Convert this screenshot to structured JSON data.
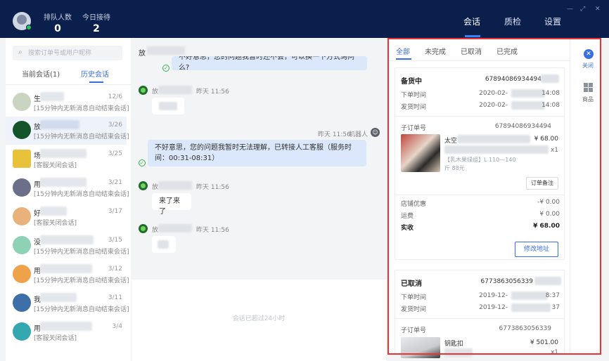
{
  "header": {
    "queue_label": "排队人数",
    "queue_value": "0",
    "today_label": "今日接待",
    "today_value": "2",
    "nav": [
      "会话",
      "质检",
      "设置"
    ]
  },
  "left": {
    "search_placeholder": "搜索订单号或用户昵称",
    "tabs": [
      "当前会话(1)",
      "历史会话"
    ],
    "conversations": [
      {
        "name": "生",
        "date": "12/6",
        "preview": "[15分钟内无新消息自动结束会话]"
      },
      {
        "name": "放",
        "date": "3/26",
        "preview": "[15分钟内无新消息自动结束会话]"
      },
      {
        "name": "场",
        "date": "3/25",
        "preview": "[客服关闭会话]"
      },
      {
        "name": "用",
        "date": "3/21",
        "preview": "[15分钟内无新消息自动结束会话]"
      },
      {
        "name": "好",
        "date": "3/17",
        "preview": "[客服关闭会话]"
      },
      {
        "name": "没",
        "date": "3/15",
        "preview": "[15分钟内无新消息自动结束会话]"
      },
      {
        "name": "用",
        "date": "3/12",
        "preview": "[15分钟内无新消息自动结束会话]"
      },
      {
        "name": "我",
        "date": "3/11",
        "preview": "[15分钟内无新消息自动结束会话]"
      },
      {
        "name": "用",
        "date": "3/4",
        "preview": "[客服关闭会话]"
      }
    ]
  },
  "chat": {
    "top_name": "放",
    "partial_msg": "不好意思，您的问题我暂时还不会，可以换一下方式询问么?",
    "user_name": "放",
    "time_yesterday": "昨天 11:56",
    "robot_label": "机器人",
    "agent_msg": "不好意思，您的问题我暂时无法理解，已转接人工客服（服务时间：00:31-08:31）",
    "user_msg2": "来了来了",
    "expired_tip": "会话已超过24小时"
  },
  "orders": {
    "tabs": [
      "全部",
      "未完成",
      "已取消",
      "已完成"
    ],
    "card1": {
      "status": "备货中",
      "order_no": "67894086934494",
      "placed_label": "下单时间",
      "placed_value": "2020-02-",
      "placed_time": "14:08",
      "ship_label": "发货时间",
      "ship_value": "2020-02-",
      "ship_time": "14:08",
      "sub_label": "子订单号",
      "sub_no": "67894086934494",
      "product_name": "太空",
      "price": "¥ 68.00",
      "qty": "x1",
      "spec": "【乳木果绿组】L 110—140",
      "spec2": "斤 88元",
      "note_button": "订单备注",
      "discount_label": "店铺优惠",
      "discount_value": "-¥ 0.00",
      "freight_label": "运费",
      "freight_value": "¥ 0.00",
      "paid_label": "实收",
      "paid_value": "¥ 68.00",
      "address_button": "修改地址"
    },
    "card2": {
      "status": "已取消",
      "order_no": "6773863056339",
      "placed_label": "下单时间",
      "placed_value": "2019-12-",
      "placed_time": "8:37",
      "ship_label": "发货时间",
      "ship_value": "2019-12-",
      "ship_time": "37",
      "sub_label": "子订单号",
      "sub_no": "6773863056339",
      "product_name": "钥匙扣",
      "price": "¥ 501.00",
      "qty": "x1"
    }
  },
  "rail": {
    "close_label": "关闭",
    "goods_label": "商品"
  }
}
